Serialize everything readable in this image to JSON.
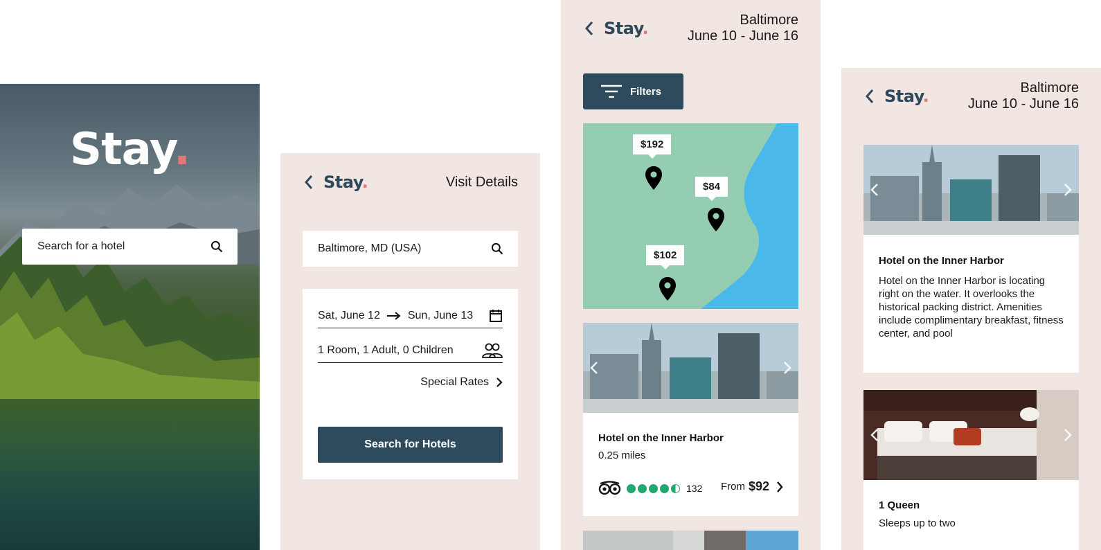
{
  "landing": {
    "logo": "Stay",
    "logo_dot": ".",
    "search_placeholder": "Search for a hotel"
  },
  "visit": {
    "logo": "Stay",
    "logo_dot": ".",
    "title": "Visit Details",
    "location": "Baltimore, MD (USA)",
    "date_start": "Sat, June 12",
    "date_end": "Sun, June 13",
    "guests": "1 Room, 1 Adult, 0 Children",
    "special_rates": "Special Rates",
    "search_button": "Search for Hotels"
  },
  "results": {
    "logo": "Stay",
    "logo_dot": ".",
    "city": "Baltimore",
    "dates": "June 10 - June 16",
    "filters_label": "Filters",
    "map_prices": [
      "$192",
      "$84",
      "$102"
    ],
    "hotel": {
      "name": "Hotel on the Inner Harbor",
      "distance": "0.25 miles",
      "rating": 4.5,
      "review_count": "132",
      "from_label": "From",
      "price": "$92"
    }
  },
  "detail": {
    "logo": "Stay",
    "logo_dot": ".",
    "city": "Baltimore",
    "dates": "June 10 - June 16",
    "hotel_name": "Hotel on the Inner Harbor",
    "description": "Hotel on the Inner Harbor is locating right on the water. It overlooks the historical packing district. Amenities include complimentary breakfast, fitness center, and pool",
    "room_name": "1 Queen",
    "room_capacity": "Sleeps up to two"
  },
  "colors": {
    "primary": "#2d4b5d",
    "accent": "#e07a78",
    "background": "#f1e6e1",
    "rating": "#20a86e",
    "map_land": "#95cdb3",
    "map_water": "#4ab9ea"
  }
}
